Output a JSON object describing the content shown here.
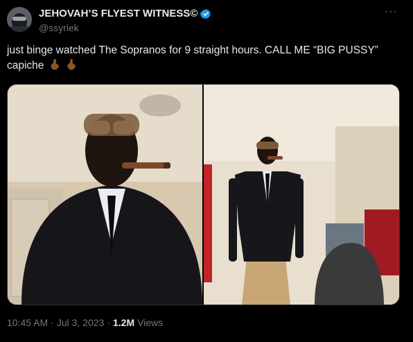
{
  "author": {
    "display_name": "JEHOVAH’S FLYEST WITNESS©",
    "handle": "@ssyriek",
    "verified_icon": "verified-badge-icon"
  },
  "more_icon": "more-horizontal-icon",
  "more_label": "···",
  "tweet": {
    "text": "just binge watched The Sopranos for 9 straight hours. CALL ME “BIG PUSSY” capiche",
    "emoji_icons": [
      "pinched-fingers-emoji-icon",
      "pinched-fingers-emoji-icon"
    ]
  },
  "media": {
    "images": [
      "photo-man-in-suit-with-cigar-closeup",
      "photo-man-in-suit-full-length"
    ]
  },
  "meta": {
    "time": "10:45 AM",
    "sep1": "·",
    "date": "Jul 3, 2023",
    "sep2": "·",
    "views_count": "1.2M",
    "views_label": "Views"
  },
  "colors": {
    "background": "#000000",
    "text": "#e7e9ea",
    "secondary": "#71767b",
    "verified": "#1d9bf0"
  }
}
